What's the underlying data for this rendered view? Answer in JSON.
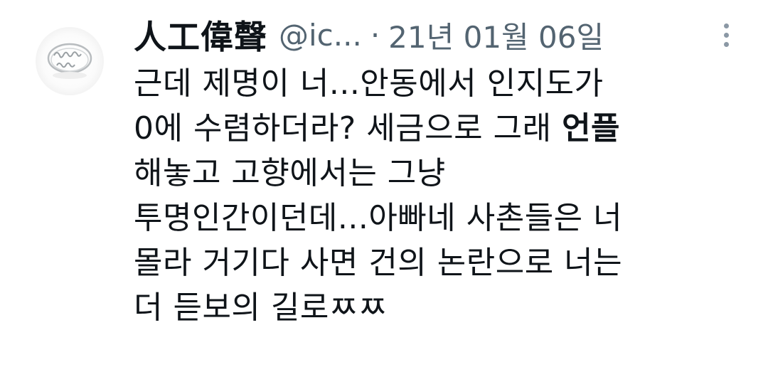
{
  "tweet": {
    "author": {
      "display_name": "人工偉聲",
      "handle": "@ic...",
      "avatar_icon": "ring-icon"
    },
    "separator": "·",
    "date": "21년 01월 06일",
    "more_icon": "more-vertical-icon",
    "body_lines": [
      "근데 제명이 너...안동에서 인지도가",
      "0에 수렴하더라? 세금으로 그래",
      "해놓고 고향에서는 그냥",
      "투명인간이던데...아빠네 사촌들은 너",
      "몰라 거기다 사면 건의 논란으로 너는",
      "더 듣보의 길로ㅉㅉ"
    ],
    "highlight": "언플"
  }
}
